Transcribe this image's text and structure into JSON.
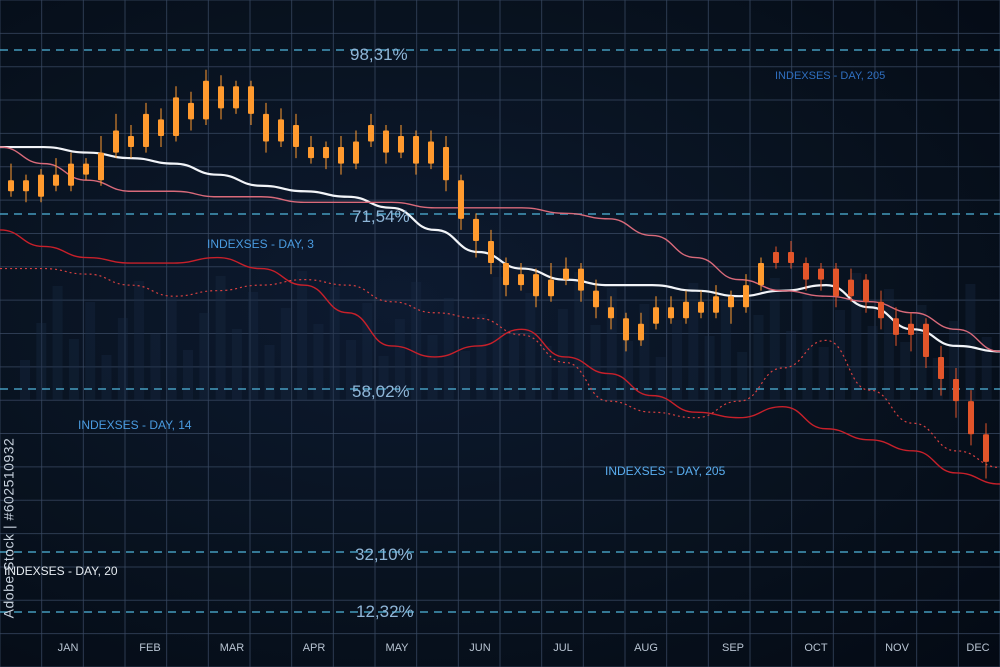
{
  "watermark": "Adobe Stock | #602510932",
  "chart_data": {
    "type": "candlestick",
    "title": "",
    "months": [
      "JAN",
      "FEB",
      "MAR",
      "APR",
      "MAY",
      "JUN",
      "JUL",
      "AUG",
      "SEP",
      "OCT",
      "NOV",
      "DEC"
    ],
    "y_scale_labels": [
      "98,31%",
      "71,54%",
      "58,02%",
      "32,10%",
      "12,32%"
    ],
    "y_scale_values": [
      98.31,
      71.54,
      58.02,
      32.1,
      12.32
    ],
    "index_labels": [
      "INDEXSES - DAY, 3",
      "INDEXSES - DAY, 14",
      "INDEXSES - DAY, 205",
      "INDEXSES - DAY, 20",
      "INDEXSES - DAY, 205"
    ],
    "grid": true,
    "candles": [
      {
        "x": "JAN",
        "o": 74,
        "c": 76,
        "h": 79,
        "l": 73
      },
      {
        "x": "JAN",
        "o": 76,
        "c": 74,
        "h": 77,
        "l": 72
      },
      {
        "x": "JAN",
        "o": 73,
        "c": 77,
        "h": 78,
        "l": 72
      },
      {
        "x": "JAN",
        "o": 77,
        "c": 75,
        "h": 80,
        "l": 74
      },
      {
        "x": "JAN",
        "o": 75,
        "c": 79,
        "h": 81,
        "l": 74
      },
      {
        "x": "JAN",
        "o": 79,
        "c": 77,
        "h": 80,
        "l": 76
      },
      {
        "x": "JAN",
        "o": 76,
        "c": 81,
        "h": 84,
        "l": 75
      },
      {
        "x": "FEB",
        "o": 81,
        "c": 85,
        "h": 88,
        "l": 80
      },
      {
        "x": "FEB",
        "o": 84,
        "c": 82,
        "h": 86,
        "l": 80
      },
      {
        "x": "FEB",
        "o": 82,
        "c": 88,
        "h": 90,
        "l": 81
      },
      {
        "x": "FEB",
        "o": 87,
        "c": 84,
        "h": 89,
        "l": 82
      },
      {
        "x": "FEB",
        "o": 84,
        "c": 91,
        "h": 93,
        "l": 83
      },
      {
        "x": "FEB",
        "o": 90,
        "c": 87,
        "h": 92,
        "l": 85
      },
      {
        "x": "FEB",
        "o": 87,
        "c": 94,
        "h": 96,
        "l": 86
      },
      {
        "x": "MAR",
        "o": 93,
        "c": 89,
        "h": 95,
        "l": 87
      },
      {
        "x": "MAR",
        "o": 89,
        "c": 93,
        "h": 94,
        "l": 88
      },
      {
        "x": "MAR",
        "o": 93,
        "c": 88,
        "h": 94,
        "l": 86
      },
      {
        "x": "MAR",
        "o": 88,
        "c": 83,
        "h": 90,
        "l": 81
      },
      {
        "x": "MAR",
        "o": 83,
        "c": 87,
        "h": 89,
        "l": 82
      },
      {
        "x": "MAR",
        "o": 86,
        "c": 82,
        "h": 88,
        "l": 80
      },
      {
        "x": "MAR",
        "o": 82,
        "c": 80,
        "h": 84,
        "l": 79
      },
      {
        "x": "APR",
        "o": 80,
        "c": 82,
        "h": 83,
        "l": 78
      },
      {
        "x": "APR",
        "o": 82,
        "c": 79,
        "h": 84,
        "l": 77
      },
      {
        "x": "APR",
        "o": 79,
        "c": 83,
        "h": 85,
        "l": 78
      },
      {
        "x": "APR",
        "o": 83,
        "c": 86,
        "h": 88,
        "l": 82
      },
      {
        "x": "APR",
        "o": 85,
        "c": 81,
        "h": 86,
        "l": 79
      },
      {
        "x": "APR",
        "o": 81,
        "c": 84,
        "h": 86,
        "l": 80
      },
      {
        "x": "MAY",
        "o": 84,
        "c": 79,
        "h": 85,
        "l": 77
      },
      {
        "x": "MAY",
        "o": 79,
        "c": 83,
        "h": 85,
        "l": 78
      },
      {
        "x": "MAY",
        "o": 82,
        "c": 76,
        "h": 84,
        "l": 74
      },
      {
        "x": "MAY",
        "o": 76,
        "c": 69,
        "h": 77,
        "l": 67
      },
      {
        "x": "MAY",
        "o": 69,
        "c": 65,
        "h": 70,
        "l": 62
      },
      {
        "x": "MAY",
        "o": 65,
        "c": 61,
        "h": 67,
        "l": 59
      },
      {
        "x": "JUN",
        "o": 61,
        "c": 57,
        "h": 62,
        "l": 55
      },
      {
        "x": "JUN",
        "o": 57,
        "c": 59,
        "h": 61,
        "l": 56
      },
      {
        "x": "JUN",
        "o": 59,
        "c": 55,
        "h": 60,
        "l": 53
      },
      {
        "x": "JUN",
        "o": 55,
        "c": 58,
        "h": 61,
        "l": 54
      },
      {
        "x": "JUN",
        "o": 58,
        "c": 60,
        "h": 62,
        "l": 57
      },
      {
        "x": "JUN",
        "o": 60,
        "c": 56,
        "h": 61,
        "l": 54
      },
      {
        "x": "JUL",
        "o": 56,
        "c": 53,
        "h": 58,
        "l": 51
      },
      {
        "x": "JUL",
        "o": 53,
        "c": 51,
        "h": 55,
        "l": 49
      },
      {
        "x": "JUL",
        "o": 51,
        "c": 47,
        "h": 52,
        "l": 45
      },
      {
        "x": "JUL",
        "o": 47,
        "c": 50,
        "h": 52,
        "l": 46
      },
      {
        "x": "JUL",
        "o": 50,
        "c": 53,
        "h": 55,
        "l": 49
      },
      {
        "x": "JUL",
        "o": 53,
        "c": 51,
        "h": 55,
        "l": 50
      },
      {
        "x": "AUG",
        "o": 51,
        "c": 54,
        "h": 56,
        "l": 50
      },
      {
        "x": "AUG",
        "o": 54,
        "c": 52,
        "h": 56,
        "l": 51
      },
      {
        "x": "AUG",
        "o": 52,
        "c": 55,
        "h": 57,
        "l": 51
      },
      {
        "x": "AUG",
        "o": 55,
        "c": 53,
        "h": 56,
        "l": 50
      },
      {
        "x": "AUG",
        "o": 53,
        "c": 57,
        "h": 59,
        "l": 52
      },
      {
        "x": "AUG",
        "o": 57,
        "c": 61,
        "h": 62,
        "l": 56
      },
      {
        "x": "SEP",
        "o": 61,
        "c": 63,
        "h": 64,
        "l": 60
      },
      {
        "x": "SEP",
        "o": 63,
        "c": 61,
        "h": 65,
        "l": 60
      },
      {
        "x": "SEP",
        "o": 61,
        "c": 58,
        "h": 62,
        "l": 56
      },
      {
        "x": "SEP",
        "o": 58,
        "c": 60,
        "h": 61,
        "l": 56
      },
      {
        "x": "OCT",
        "o": 60,
        "c": 55,
        "h": 61,
        "l": 53
      },
      {
        "x": "OCT",
        "o": 55,
        "c": 58,
        "h": 60,
        "l": 54
      },
      {
        "x": "OCT",
        "o": 58,
        "c": 54,
        "h": 59,
        "l": 52
      },
      {
        "x": "OCT",
        "o": 54,
        "c": 51,
        "h": 56,
        "l": 49
      },
      {
        "x": "NOV",
        "o": 51,
        "c": 48,
        "h": 53,
        "l": 46
      },
      {
        "x": "NOV",
        "o": 48,
        "c": 50,
        "h": 52,
        "l": 45
      },
      {
        "x": "NOV",
        "o": 50,
        "c": 44,
        "h": 51,
        "l": 42
      },
      {
        "x": "NOV",
        "o": 44,
        "c": 40,
        "h": 46,
        "l": 37
      },
      {
        "x": "DEC",
        "o": 40,
        "c": 36,
        "h": 42,
        "l": 33
      },
      {
        "x": "DEC",
        "o": 36,
        "c": 30,
        "h": 38,
        "l": 28
      },
      {
        "x": "DEC",
        "o": 30,
        "c": 25,
        "h": 32,
        "l": 22
      }
    ],
    "series": [
      {
        "key": "white",
        "color": "#f2f4f8",
        "values": [
          82,
          82,
          81,
          80,
          79,
          77,
          75,
          74,
          73,
          71,
          67,
          63,
          60,
          58,
          57,
          57,
          56,
          55,
          56,
          57,
          53,
          49,
          46,
          45
        ]
      },
      {
        "key": "pink",
        "color": "#d96a7a",
        "values": [
          82,
          79,
          76,
          74,
          74,
          73,
          73,
          72,
          72,
          72,
          71,
          71,
          71,
          70,
          69,
          66,
          62,
          58,
          56,
          55,
          54,
          52,
          49,
          45
        ]
      },
      {
        "key": "red",
        "color": "#c8202a",
        "values": [
          67,
          64,
          62,
          61,
          61,
          62,
          60,
          57,
          52,
          46,
          44,
          46,
          49,
          44,
          41,
          37,
          34,
          33,
          35,
          31,
          29,
          27,
          23,
          21
        ]
      },
      {
        "key": "dotted",
        "color": "#d94040",
        "values": [
          60,
          60,
          59,
          57,
          55,
          56,
          57,
          58,
          57,
          54,
          52,
          51,
          48,
          43,
          36,
          34,
          33,
          36,
          42,
          47,
          38,
          32,
          27,
          24
        ]
      }
    ]
  }
}
